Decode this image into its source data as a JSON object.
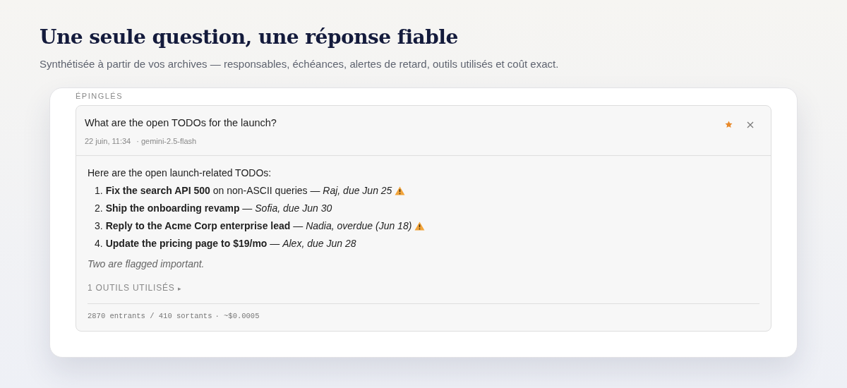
{
  "heading": {
    "title": "Une seule question, une réponse fiable",
    "subtitle": "Synthétisée à partir de vos archives — responsables, échéances, alertes de retard, outils utilisés et coût exact."
  },
  "section_label": "ÉPINGLÉS",
  "pinned_item": {
    "question": "What are the open TODOs for the launch?",
    "date": "22 juin, 11:34",
    "model": "· gemini-2.5-flash",
    "starred": true,
    "answer": {
      "intro": "Here are the open launch-related TODOs:",
      "items": [
        {
          "number": "1.",
          "text": "**Fix the search API 500** on non-ASCII queries — *Raj, due Jun 25*",
          "warning": true
        },
        {
          "number": "2.",
          "text": "**Ship the onboarding revamp** — *Sofia, due Jun 30*",
          "warning": false
        },
        {
          "number": "3.",
          "text": "**Reply to the Acme Corp enterprise lead** — *Nadia, overdue (Jun 18)*",
          "warning": true
        },
        {
          "number": "4.",
          "text": "**Update the pricing page to $19/mo** — *Alex, due Jun 28*",
          "warning": false
        }
      ],
      "note": "Two are flagged important."
    },
    "tools": {
      "label": "1 OUTILS UTILISÉS",
      "caret": "▸",
      "expanded": false
    },
    "usage": "2870 entrants / 410 sortants",
    "cost": "· ~$0.0005"
  }
}
